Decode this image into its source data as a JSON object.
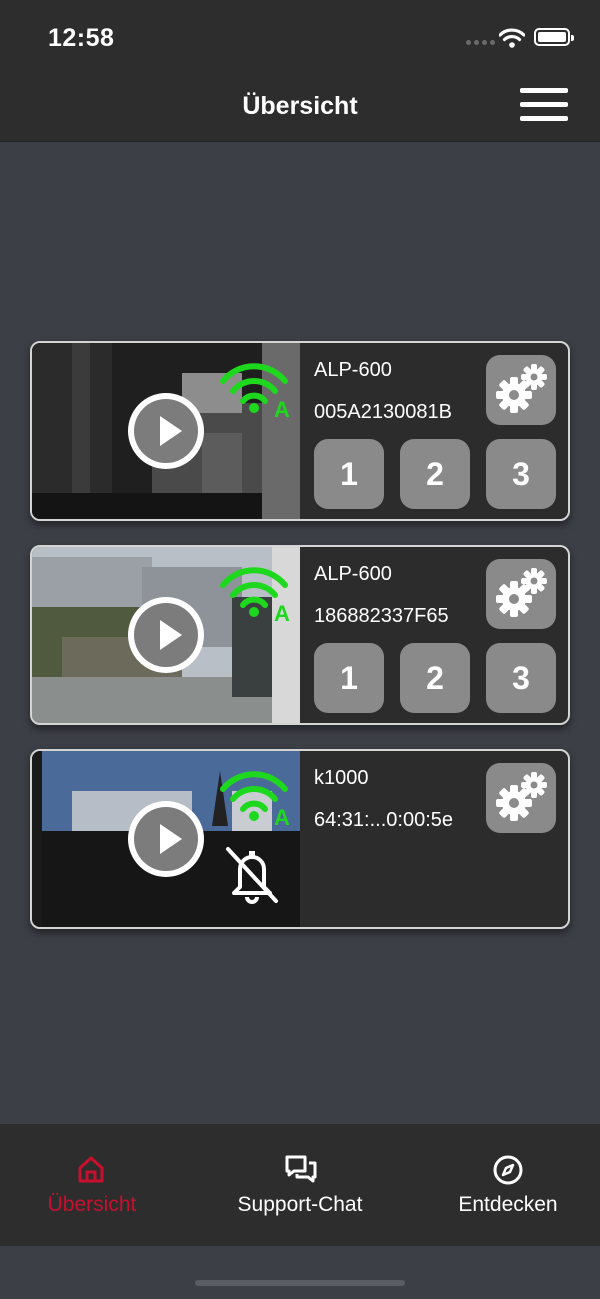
{
  "status_bar": {
    "time": "12:58"
  },
  "nav": {
    "title": "Übersicht"
  },
  "devices": [
    {
      "name": "ALP-600",
      "id": "005A2130081B",
      "overlay": "A",
      "channels": [
        "1",
        "2",
        "3"
      ]
    },
    {
      "name": "ALP-600",
      "id": "186882337F65",
      "overlay": "A",
      "channels": [
        "1",
        "2",
        "3"
      ]
    },
    {
      "name": "k1000",
      "id": "64:31:...0:00:5e",
      "overlay": "A",
      "channels": []
    }
  ],
  "tabs": [
    {
      "label": "Übersicht",
      "icon": "home-icon",
      "active": true
    },
    {
      "label": "Support-Chat",
      "icon": "chat-icon",
      "active": false
    },
    {
      "label": "Entdecken",
      "icon": "compass-icon",
      "active": false
    }
  ],
  "colors": {
    "accent": "#c8102e",
    "signal": "#1ed81e",
    "background": "#3d3f47",
    "bar": "#2d2d2d",
    "button": "#8a8a8a"
  }
}
